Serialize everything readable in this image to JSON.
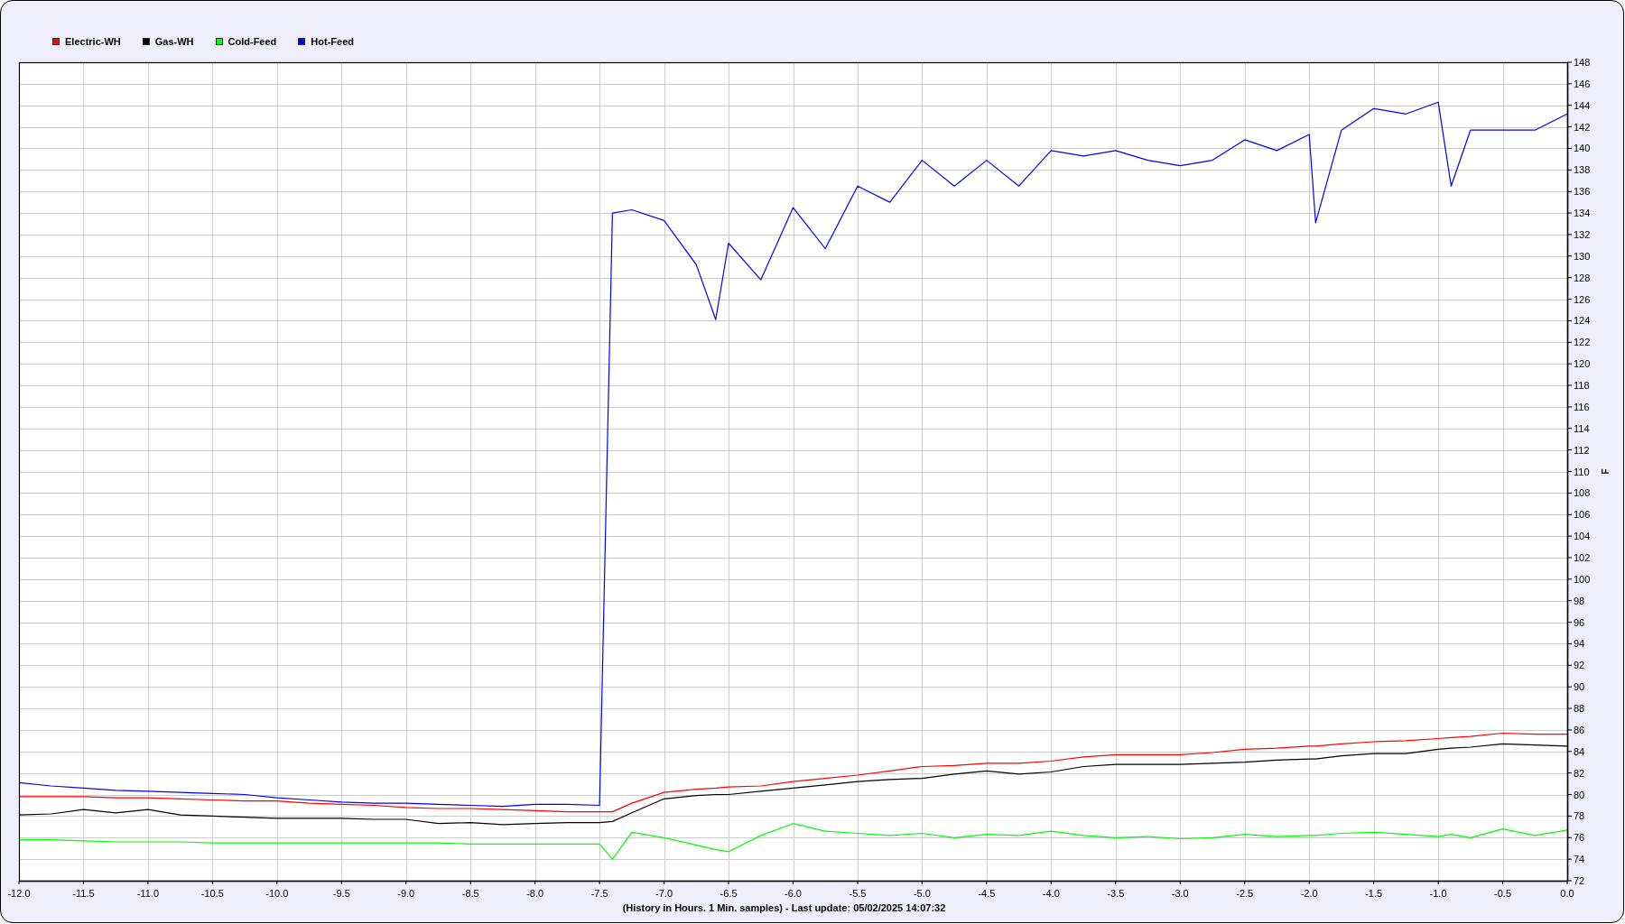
{
  "chart": {
    "chart_data": {
      "type": "line",
      "grid": true,
      "xlabel": "(History in Hours. 1 Min. samples) - Last update: 05/02/2025 14:07:32",
      "ylabel": "F",
      "x": [
        -12,
        -11.75,
        -11.5,
        -11.25,
        -11,
        -10.75,
        -10.5,
        -10.25,
        -10,
        -9.75,
        -9.5,
        -9.25,
        -9,
        -8.75,
        -8.5,
        -8.25,
        -8,
        -7.75,
        -7.5,
        -7.4,
        -7.25,
        -7,
        -6.75,
        -6.6,
        -6.5,
        -6.25,
        -6,
        -5.75,
        -5.5,
        -5.25,
        -5,
        -4.75,
        -4.5,
        -4.25,
        -4,
        -3.75,
        -3.5,
        -3.25,
        -3,
        -2.75,
        -2.5,
        -2.25,
        -2,
        -1.95,
        -1.75,
        -1.5,
        -1.25,
        -1,
        -0.9,
        -0.75,
        -0.5,
        -0.25,
        0
      ],
      "series": [
        {
          "name": "Electric-WH",
          "color": "#ff0000",
          "values": [
            79.8,
            79.8,
            79.8,
            79.7,
            79.7,
            79.6,
            79.5,
            79.4,
            79.4,
            79.2,
            79.1,
            79.0,
            78.8,
            78.7,
            78.7,
            78.6,
            78.5,
            78.4,
            78.4,
            78.4,
            79.2,
            80.2,
            80.5,
            80.6,
            80.7,
            80.8,
            81.2,
            81.5,
            81.8,
            82.2,
            82.6,
            82.7,
            82.9,
            82.9,
            83.1,
            83.5,
            83.7,
            83.7,
            83.7,
            83.9,
            84.2,
            84.3,
            84.5,
            84.5,
            84.7,
            84.9,
            85.0,
            85.2,
            85.3,
            85.4,
            85.7,
            85.6,
            85.6
          ]
        },
        {
          "name": "Gas-WH",
          "color": "#000000",
          "values": [
            78.1,
            78.2,
            78.6,
            78.3,
            78.6,
            78.1,
            78.0,
            77.9,
            77.8,
            77.8,
            77.8,
            77.7,
            77.7,
            77.3,
            77.4,
            77.2,
            77.3,
            77.4,
            77.4,
            77.5,
            78.3,
            79.6,
            79.9,
            80.0,
            80.0,
            80.3,
            80.6,
            80.9,
            81.2,
            81.4,
            81.5,
            81.9,
            82.2,
            81.9,
            82.1,
            82.6,
            82.8,
            82.8,
            82.8,
            82.9,
            83.0,
            83.2,
            83.3,
            83.3,
            83.6,
            83.8,
            83.8,
            84.2,
            84.3,
            84.4,
            84.7,
            84.6,
            84.5
          ]
        },
        {
          "name": "Cold-Feed",
          "color": "#00ff00",
          "values": [
            75.8,
            75.8,
            75.7,
            75.6,
            75.6,
            75.6,
            75.5,
            75.5,
            75.5,
            75.5,
            75.5,
            75.5,
            75.5,
            75.5,
            75.4,
            75.4,
            75.4,
            75.4,
            75.4,
            74.0,
            76.5,
            76.0,
            75.3,
            74.9,
            74.7,
            76.2,
            77.3,
            76.6,
            76.4,
            76.2,
            76.4,
            76.0,
            76.3,
            76.2,
            76.6,
            76.2,
            76.0,
            76.1,
            75.9,
            76.0,
            76.3,
            76.1,
            76.2,
            76.2,
            76.4,
            76.5,
            76.3,
            76.1,
            76.3,
            76.0,
            76.8,
            76.2,
            76.7
          ]
        },
        {
          "name": "Hot-Feed",
          "color": "#0000ff",
          "values": [
            81.1,
            80.8,
            80.6,
            80.4,
            80.3,
            80.2,
            80.1,
            80.0,
            79.7,
            79.5,
            79.3,
            79.2,
            79.2,
            79.1,
            79.0,
            78.9,
            79.1,
            79.1,
            79.0,
            134.0,
            134.3,
            133.3,
            129.2,
            124.1,
            131.2,
            127.8,
            134.5,
            130.7,
            136.5,
            135.0,
            138.9,
            136.5,
            138.9,
            136.5,
            139.8,
            139.3,
            139.8,
            138.9,
            138.4,
            138.9,
            140.8,
            139.8,
            141.3,
            133.1,
            141.7,
            143.7,
            143.2,
            144.3,
            136.5,
            141.7,
            141.7,
            141.7,
            143.2
          ]
        }
      ],
      "xlim": [
        -12,
        0
      ],
      "ylim": [
        72,
        148
      ],
      "xticks": [
        {
          "value": -12,
          "label": "-12.0"
        },
        {
          "value": -11.5,
          "label": "-11.5"
        },
        {
          "value": -11,
          "label": "-11.0"
        },
        {
          "value": -10.5,
          "label": "-10.5"
        },
        {
          "value": -10,
          "label": "-10.0"
        },
        {
          "value": -9.5,
          "label": "-9.5"
        },
        {
          "value": -9,
          "label": "-9.0"
        },
        {
          "value": -8.5,
          "label": "-8.5"
        },
        {
          "value": -8,
          "label": "-8.0"
        },
        {
          "value": -7.5,
          "label": "-7.5"
        },
        {
          "value": -7,
          "label": "-7.0"
        },
        {
          "value": -6.5,
          "label": "-6.5"
        },
        {
          "value": -6,
          "label": "-6.0"
        },
        {
          "value": -5.5,
          "label": "-5.5"
        },
        {
          "value": -5,
          "label": "-5.0"
        },
        {
          "value": -4.5,
          "label": "-4.5"
        },
        {
          "value": -4,
          "label": "-4.0"
        },
        {
          "value": -3.5,
          "label": "-3.5"
        },
        {
          "value": -3,
          "label": "-3.0"
        },
        {
          "value": -2.5,
          "label": "-2.5"
        },
        {
          "value": -2,
          "label": "-2.0"
        },
        {
          "value": -1.5,
          "label": "-1.5"
        },
        {
          "value": -1,
          "label": "-1.0"
        },
        {
          "value": -0.5,
          "label": "-0.5"
        },
        {
          "value": 0,
          "label": "0.0"
        }
      ],
      "yticks": [
        72,
        74,
        76,
        78,
        80,
        82,
        84,
        86,
        88,
        90,
        92,
        94,
        96,
        98,
        100,
        102,
        104,
        106,
        108,
        110,
        112,
        114,
        116,
        118,
        120,
        122,
        124,
        126,
        128,
        130,
        132,
        134,
        136,
        138,
        140,
        142,
        144,
        146,
        148
      ]
    }
  }
}
